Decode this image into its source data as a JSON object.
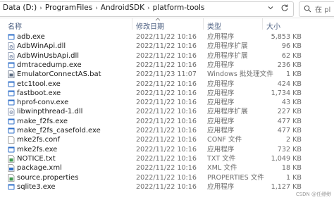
{
  "address": {
    "crumbs": [
      "Data (D:)",
      "ProgramFiles",
      "AndroidSDK",
      "platform-tools"
    ],
    "separator": "›",
    "search_placeholder": "在 pl"
  },
  "columns": {
    "name": "名称",
    "date": "修改日期",
    "type": "类型",
    "size": "大小"
  },
  "icon_colors": {
    "exe": "#2f6fc9",
    "dll": "#7a8aa8",
    "bat": "#5c6b82",
    "txt": "#3f9a4f",
    "xml": "#2f6fc9",
    "conf": "#ffffff"
  },
  "files": [
    {
      "name": "adb.exe",
      "date": "2022/11/22 10:16",
      "type": "应用程序",
      "size": "5,853 KB",
      "icon": "exe-icon",
      "kind": "exe"
    },
    {
      "name": "AdbWinApi.dll",
      "date": "2022/11/22 10:16",
      "type": "应用程序扩展",
      "size": "96 KB",
      "icon": "dll-icon",
      "kind": "dll"
    },
    {
      "name": "AdbWinUsbApi.dll",
      "date": "2022/11/22 10:16",
      "type": "应用程序扩展",
      "size": "62 KB",
      "icon": "dll-icon",
      "kind": "dll"
    },
    {
      "name": "dmtracedump.exe",
      "date": "2022/11/22 10:16",
      "type": "应用程序",
      "size": "236 KB",
      "icon": "exe-icon",
      "kind": "exe"
    },
    {
      "name": "EmulatorConnectAS.bat",
      "date": "2022/11/23 11:07",
      "type": "Windows 批处理文件",
      "size": "1 KB",
      "icon": "bat-icon",
      "kind": "bat"
    },
    {
      "name": "etc1tool.exe",
      "date": "2022/11/22 10:16",
      "type": "应用程序",
      "size": "424 KB",
      "icon": "exe-icon",
      "kind": "exe"
    },
    {
      "name": "fastboot.exe",
      "date": "2022/11/22 10:16",
      "type": "应用程序",
      "size": "1,734 KB",
      "icon": "exe-icon",
      "kind": "exe"
    },
    {
      "name": "hprof-conv.exe",
      "date": "2022/11/22 10:16",
      "type": "应用程序",
      "size": "43 KB",
      "icon": "exe-icon",
      "kind": "exe"
    },
    {
      "name": "libwinpthread-1.dll",
      "date": "2022/11/22 10:16",
      "type": "应用程序扩展",
      "size": "227 KB",
      "icon": "dll-icon",
      "kind": "dll"
    },
    {
      "name": "make_f2fs.exe",
      "date": "2022/11/22 10:16",
      "type": "应用程序",
      "size": "477 KB",
      "icon": "exe-icon",
      "kind": "exe"
    },
    {
      "name": "make_f2fs_casefold.exe",
      "date": "2022/11/22 10:16",
      "type": "应用程序",
      "size": "477 KB",
      "icon": "exe-icon",
      "kind": "exe"
    },
    {
      "name": "mke2fs.conf",
      "date": "2022/11/22 10:16",
      "type": "CONF 文件",
      "size": "2 KB",
      "icon": "conf-icon",
      "kind": "conf"
    },
    {
      "name": "mke2fs.exe",
      "date": "2022/11/22 10:16",
      "type": "应用程序",
      "size": "732 KB",
      "icon": "exe-icon",
      "kind": "exe"
    },
    {
      "name": "NOTICE.txt",
      "date": "2022/11/22 10:16",
      "type": "TXT 文件",
      "size": "1,049 KB",
      "icon": "txt-icon",
      "kind": "txt"
    },
    {
      "name": "package.xml",
      "date": "2022/11/22 10:16",
      "type": "XML 文件",
      "size": "18 KB",
      "icon": "xml-icon",
      "kind": "xml"
    },
    {
      "name": "source.properties",
      "date": "2022/11/22 10:16",
      "type": "PROPERTIES 文件",
      "size": "1 KB",
      "icon": "properties-icon",
      "kind": "txt"
    },
    {
      "name": "sqlite3.exe",
      "date": "2022/11/22 10:16",
      "type": "应用程序",
      "size": "1,127 KB",
      "icon": "exe-icon",
      "kind": "exe"
    }
  ],
  "watermark": "CSDN @任缥缈"
}
